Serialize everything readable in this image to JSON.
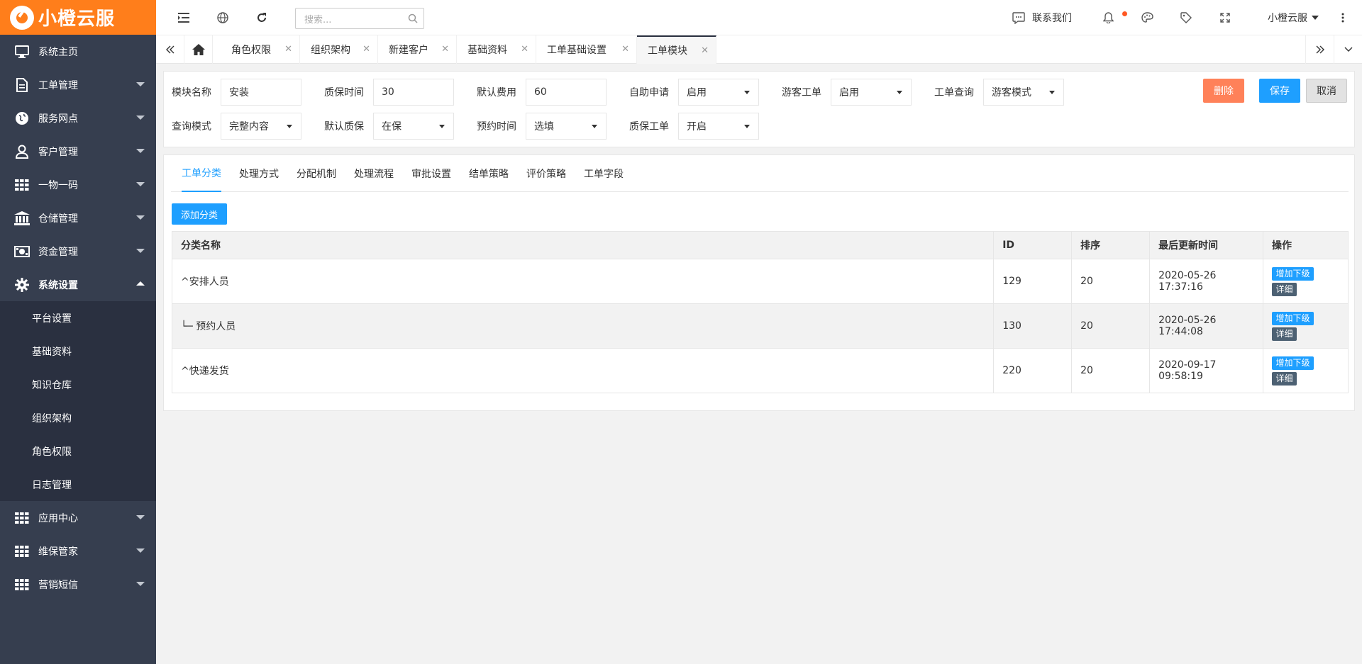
{
  "logo": {
    "text": "小橙云服"
  },
  "sidebar": {
    "items": [
      {
        "label": "系统主页",
        "icon": "monitor-icon"
      },
      {
        "label": "工单管理",
        "icon": "document-icon"
      },
      {
        "label": "服务网点",
        "icon": "globe-icon"
      },
      {
        "label": "客户管理",
        "icon": "user-icon"
      },
      {
        "label": "一物一码",
        "icon": "grid-icon"
      },
      {
        "label": "仓储管理",
        "icon": "bank-icon"
      },
      {
        "label": "资金管理",
        "icon": "money-icon"
      },
      {
        "label": "系统设置",
        "icon": "gear-icon"
      }
    ],
    "sub_items": [
      "平台设置",
      "基础资料",
      "知识仓库",
      "组织架构",
      "角色权限",
      "日志管理"
    ],
    "bottom_items": [
      {
        "label": "应用中心",
        "icon": "grid-icon"
      },
      {
        "label": "维保管家",
        "icon": "grid-icon"
      },
      {
        "label": "营销短信",
        "icon": "grid-icon"
      }
    ]
  },
  "header": {
    "search_placeholder": "搜索...",
    "contact_label": "联系我们",
    "user_label": "小橙云服"
  },
  "tabs": [
    {
      "label": "角色权限"
    },
    {
      "label": "组织架构"
    },
    {
      "label": "新建客户"
    },
    {
      "label": "基础资料"
    },
    {
      "label": "工单基础设置"
    },
    {
      "label": "工单模块"
    }
  ],
  "form": {
    "module_name_label": "模块名称",
    "module_name_value": "安装",
    "warranty_time_label": "质保时间",
    "warranty_time_value": "30",
    "default_fee_label": "默认费用",
    "default_fee_value": "60",
    "self_apply_label": "自助申请",
    "self_apply_value": "启用",
    "guest_ticket_label": "游客工单",
    "guest_ticket_value": "启用",
    "ticket_query_label": "工单查询",
    "ticket_query_value": "游客模式",
    "query_mode_label": "查询模式",
    "query_mode_value": "完整内容",
    "default_warranty_label": "默认质保",
    "default_warranty_value": "在保",
    "appointment_label": "预约时间",
    "appointment_value": "选填",
    "warranty_ticket_label": "质保工单",
    "warranty_ticket_value": "开启",
    "delete_label": "删除",
    "save_label": "保存",
    "cancel_label": "取消"
  },
  "subtabs": [
    "工单分类",
    "处理方式",
    "分配机制",
    "处理流程",
    "审批设置",
    "结单策略",
    "评价策略",
    "工单字段"
  ],
  "add_category_label": "添加分类",
  "table": {
    "headers": [
      "分类名称",
      "ID",
      "排序",
      "最后更新时间",
      "操作"
    ],
    "rows": [
      {
        "name": "^安排人员",
        "id": "129",
        "sort": "20",
        "updated": "2020-05-26 17:37:16"
      },
      {
        "name": "└─ 预约人员",
        "id": "130",
        "sort": "20",
        "updated": "2020-05-26 17:44:08"
      },
      {
        "name": "^快递发货",
        "id": "220",
        "sort": "20",
        "updated": "2020-09-17 09:58:19"
      }
    ],
    "op_add_label": "增加下级",
    "op_detail_label": "详细"
  },
  "colors": {
    "brand": "#ff7e1b",
    "sidebar": "#363e4f",
    "primary": "#1e9fff",
    "danger": "#ff5722"
  }
}
